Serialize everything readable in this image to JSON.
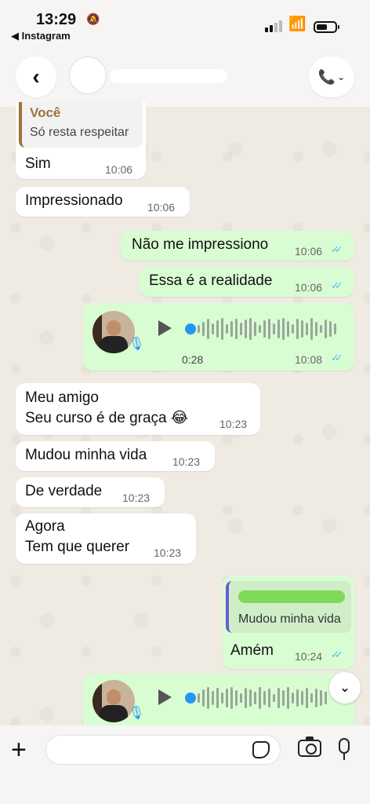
{
  "status_bar": {
    "time": "13:29",
    "back_app": "◀ Instagram"
  },
  "header": {
    "back_icon": "chevron-left-icon",
    "call_icon": "phone-icon"
  },
  "messages": [
    {
      "side": "in",
      "quote_author": "Você",
      "quote_text": "Só resta respeitar",
      "text": "Sim",
      "time": "10:06"
    },
    {
      "side": "in",
      "text": "Impressionado",
      "time": "10:06"
    },
    {
      "side": "out",
      "text": "Não me impressiono",
      "time": "10:06"
    },
    {
      "side": "out",
      "text": "Essa é a realidade",
      "time": "10:06"
    },
    {
      "side": "out",
      "type": "voice",
      "duration": "0:28",
      "time": "10:08"
    },
    {
      "side": "in",
      "lines": [
        "Meu amigo",
        "Seu curso é de graça 😂"
      ],
      "time": "10:23"
    },
    {
      "side": "in",
      "text": "Mudou minha vida",
      "time": "10:23"
    },
    {
      "side": "in",
      "text": "De verdade",
      "time": "10:23"
    },
    {
      "side": "in",
      "lines": [
        "Agora",
        "Tem que querer"
      ],
      "time": "10:23"
    },
    {
      "side": "out",
      "quote_text": "Mudou minha vida",
      "text": "Amém",
      "time": "10:24"
    },
    {
      "side": "out",
      "type": "voice"
    }
  ],
  "composer": {
    "plus_icon": "plus-icon",
    "sticker_icon": "sticker-icon",
    "camera_icon": "camera-icon",
    "mic_icon": "microphone-icon"
  },
  "colors": {
    "incoming": "#ffffff",
    "outgoing": "#d9fdd3",
    "read_ticks": "#53bdeb",
    "background": "#efeae2"
  }
}
